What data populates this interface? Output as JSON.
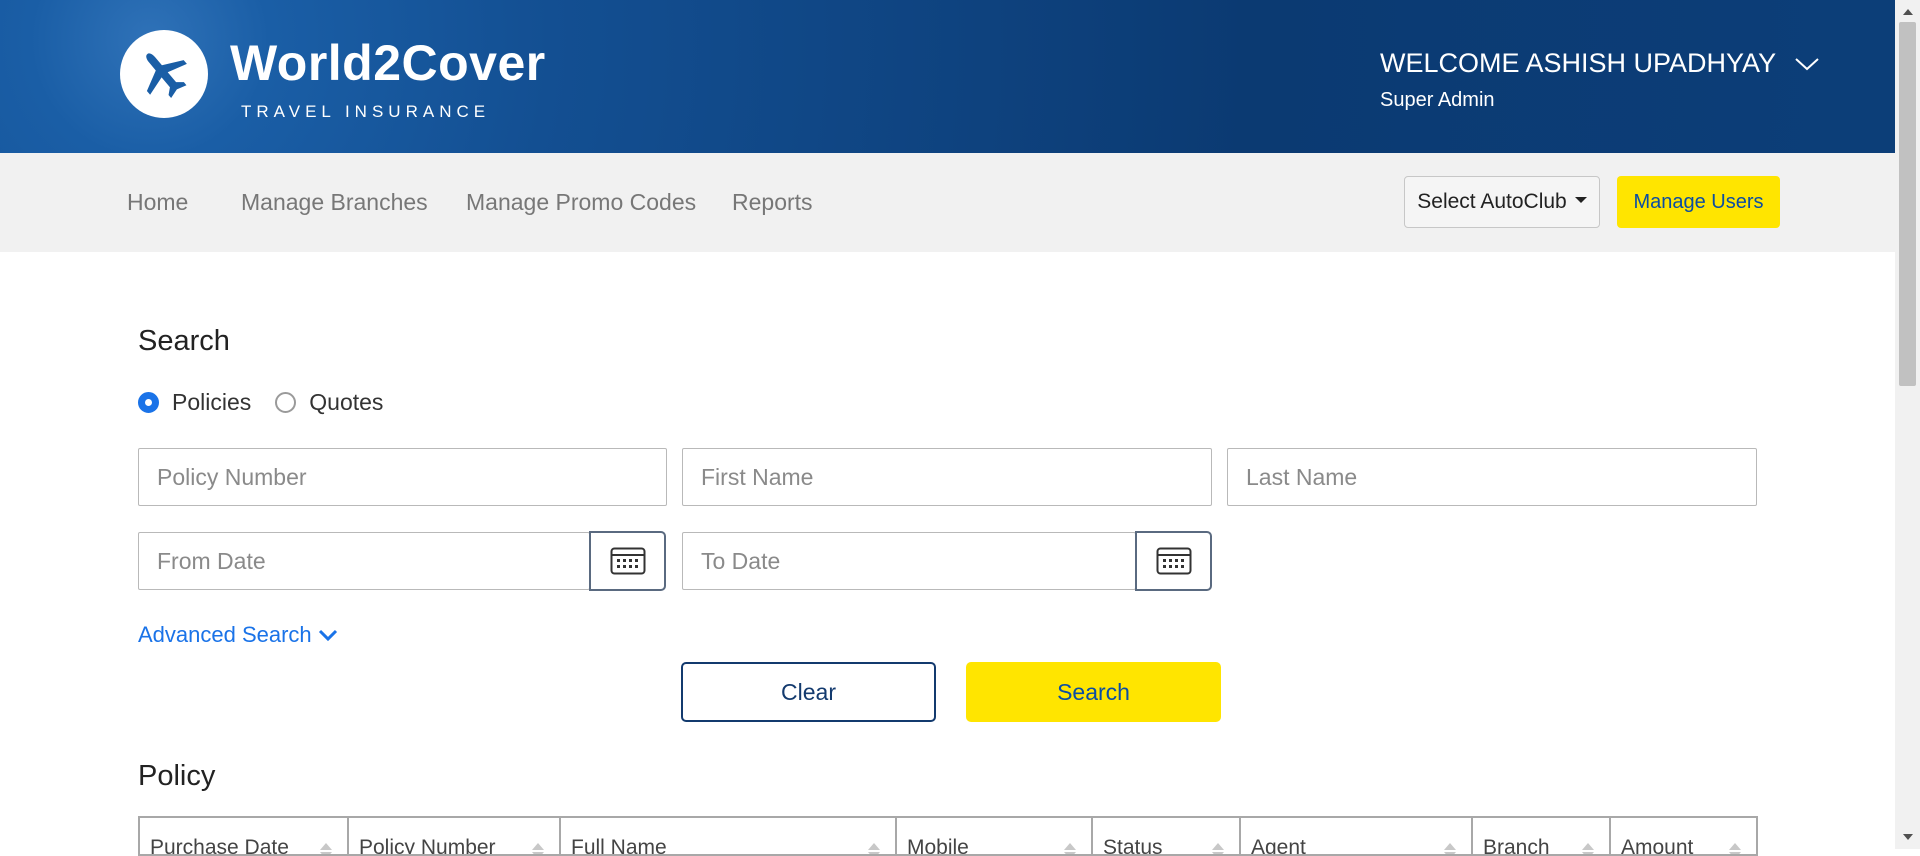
{
  "brand": {
    "name": "World2Cover",
    "tagline": "TRAVEL INSURANCE"
  },
  "user": {
    "welcome": "WELCOME ASHISH UPADHYAY",
    "role": "Super Admin"
  },
  "nav": {
    "items": [
      {
        "label": "Home"
      },
      {
        "label": "Manage Branches"
      },
      {
        "label": "Manage Promo Codes"
      },
      {
        "label": "Reports"
      }
    ],
    "autoclub_label": "Select AutoClub",
    "manage_users_label": "Manage Users"
  },
  "search": {
    "title": "Search",
    "radio_options": [
      {
        "label": "Policies",
        "checked": true
      },
      {
        "label": "Quotes",
        "checked": false
      }
    ],
    "policy_number_placeholder": "Policy Number",
    "first_name_placeholder": "First Name",
    "last_name_placeholder": "Last Name",
    "from_date_placeholder": "From Date",
    "to_date_placeholder": "To Date",
    "advanced_label": "Advanced Search",
    "clear_label": "Clear",
    "search_label": "Search"
  },
  "policy": {
    "title": "Policy",
    "columns": [
      "Purchase Date",
      "Policy Number",
      "Full Name",
      "Mobile",
      "Status",
      "Agent",
      "Branch",
      "Amount"
    ]
  },
  "icons": {
    "calendar": "calendar-icon",
    "sort": "sort-icon",
    "chevron": "chevron-down-icon",
    "plane": "plane-icon"
  },
  "colors": {
    "header_blue": "#134f92",
    "accent_yellow": "#ffe500",
    "link_blue": "#1a73e8",
    "button_text_blue": "#0b4da3"
  }
}
